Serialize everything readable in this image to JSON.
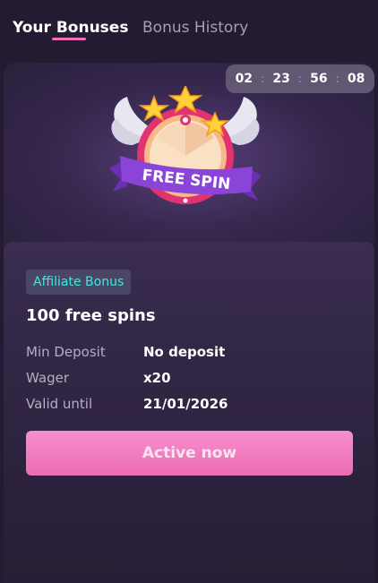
{
  "tabs": {
    "active_label": "Your Bonuses",
    "inactive_label": "Bonus History"
  },
  "countdown": {
    "hours_a": "02",
    "minutes_a": "23",
    "seconds_a": "56",
    "seconds_b": "08",
    "separator": ":"
  },
  "badge": {
    "text": "FREE SPIN",
    "icon": "free-spin-wheel-icon"
  },
  "bonus": {
    "tag": "Affiliate Bonus",
    "title": "100 free spins",
    "rows": [
      {
        "label": "Min Deposit",
        "value": "No deposit"
      },
      {
        "label": "Wager",
        "value": "x20"
      },
      {
        "label": "Valid until",
        "value": "21/01/2026"
      }
    ],
    "button_label": "Active now"
  },
  "colors": {
    "accent_pink": "#ef6fb9",
    "tag_text": "#3ee8df",
    "background": "#231b31"
  }
}
